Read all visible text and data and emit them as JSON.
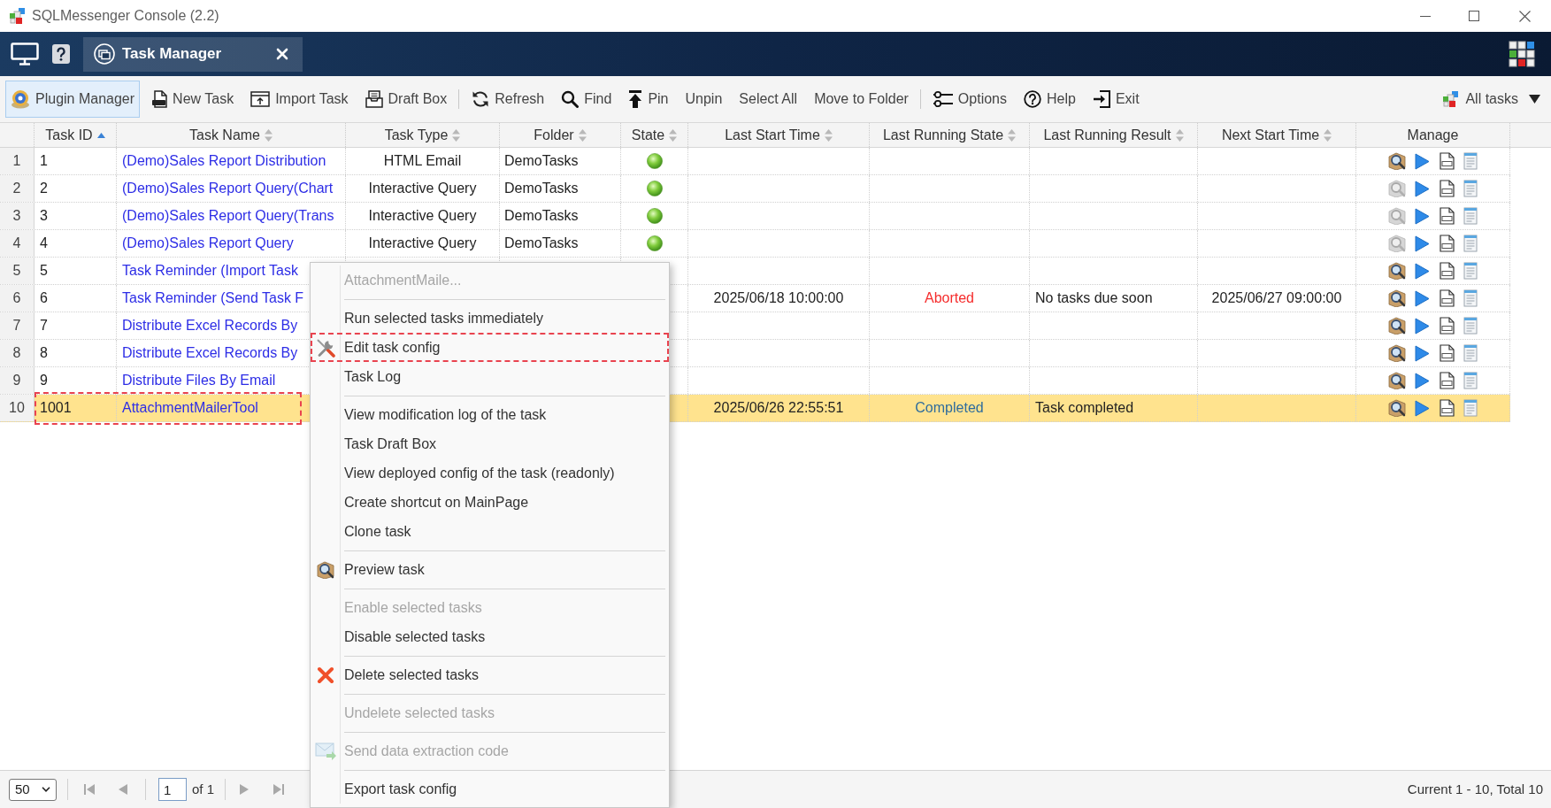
{
  "window": {
    "title": "SQLMessenger Console (2.2)"
  },
  "tabs": [
    {
      "label": "Task Manager",
      "selected": true
    }
  ],
  "toolbar": {
    "groups": [
      {
        "items": [
          {
            "label": "Plugin Manager",
            "highlighted": true
          },
          {
            "label": "New Task",
            "highlighted": false
          },
          {
            "label": "Import Task",
            "highlighted": false
          },
          {
            "label": "Draft Box",
            "highlighted": false
          }
        ]
      },
      {
        "items": [
          {
            "label": "Refresh",
            "highlighted": false
          },
          {
            "label": "Find",
            "highlighted": false
          },
          {
            "label": "Pin",
            "highlighted": false
          },
          {
            "label": "Unpin",
            "highlighted": false
          },
          {
            "label": "Select All",
            "highlighted": false
          },
          {
            "label": "Move to Folder",
            "highlighted": false
          }
        ]
      },
      {
        "items": [
          {
            "label": "Options",
            "highlighted": false
          },
          {
            "label": "Help",
            "highlighted": false
          },
          {
            "label": "Exit",
            "highlighted": false
          }
        ]
      }
    ],
    "filter": {
      "label": "All tasks"
    }
  },
  "table": {
    "columns": [
      {
        "label": "Task ID",
        "sorted": true
      },
      {
        "label": "Task Name",
        "sorted": false
      },
      {
        "label": "Task Type",
        "sorted": false
      },
      {
        "label": "Folder",
        "sorted": false
      },
      {
        "label": "State",
        "sorted": false
      },
      {
        "label": "Last Start Time",
        "sorted": false
      },
      {
        "label": "Last Running State",
        "sorted": false
      },
      {
        "label": "Last Running Result",
        "sorted": false
      },
      {
        "label": "Next Start Time",
        "sorted": false
      },
      {
        "label": "Manage"
      }
    ],
    "rows": [
      {
        "number": "1",
        "task_id": "1",
        "task_name": "(Demo)Sales Report Distribution",
        "task_type": "HTML Email",
        "folder": "DemoTasks",
        "state_on": true,
        "preview_enabled": true,
        "selected": false,
        "outlined": false
      },
      {
        "number": "2",
        "task_id": "2",
        "task_name": "(Demo)Sales Report Query(Chart",
        "task_type": "Interactive Query",
        "folder": "DemoTasks",
        "state_on": true,
        "preview_enabled": false,
        "selected": false,
        "outlined": false
      },
      {
        "number": "3",
        "task_id": "3",
        "task_name": "(Demo)Sales Report Query(Trans",
        "task_type": "Interactive Query",
        "folder": "DemoTasks",
        "state_on": true,
        "preview_enabled": false,
        "selected": false,
        "outlined": false
      },
      {
        "number": "4",
        "task_id": "4",
        "task_name": "(Demo)Sales Report Query",
        "task_type": "Interactive Query",
        "folder": "DemoTasks",
        "state_on": true,
        "preview_enabled": false,
        "selected": false,
        "outlined": false
      },
      {
        "number": "5",
        "task_id": "5",
        "task_name": "Task Reminder (Import Task",
        "preview_enabled": true,
        "selected": false,
        "outlined": false
      },
      {
        "number": "6",
        "task_id": "6",
        "task_name": "Task Reminder (Send Task F",
        "last_start_time": "2025/06/18 10:00:00",
        "last_running_state": {
          "text": "Aborted",
          "color": "#f52c2c"
        },
        "last_running_result": "No tasks due soon",
        "next_start_time": "2025/06/27 09:00:00",
        "preview_enabled": true,
        "selected": false,
        "outlined": false
      },
      {
        "number": "7",
        "task_id": "7",
        "task_name": "Distribute Excel Records By",
        "preview_enabled": true,
        "selected": false,
        "outlined": false
      },
      {
        "number": "8",
        "task_id": "8",
        "task_name": "Distribute Excel Records By",
        "preview_enabled": true,
        "selected": false,
        "outlined": false
      },
      {
        "number": "9",
        "task_id": "9",
        "task_name": "Distribute Files By Email",
        "preview_enabled": true,
        "selected": false,
        "outlined": false
      },
      {
        "number": "10",
        "task_id": "1001",
        "task_name": "AttachmentMailerTool",
        "last_start_time": "2025/06/26 22:55:51",
        "last_running_state": {
          "text": "Completed",
          "color": "#2e6c9c"
        },
        "last_running_result": "Task completed",
        "preview_enabled": true,
        "selected": true,
        "outlined": true
      }
    ]
  },
  "context_menu": {
    "groups": [
      {
        "items": [
          {
            "label": "AttachmentMaile...",
            "disabled": true,
            "outlined": false
          }
        ]
      },
      {
        "items": [
          {
            "label": "Run selected tasks immediately",
            "disabled": false,
            "outlined": false
          },
          {
            "label": "Edit task config",
            "disabled": false,
            "outlined": true
          },
          {
            "label": "Task Log",
            "disabled": false,
            "outlined": false
          }
        ]
      },
      {
        "items": [
          {
            "label": "View modification log of the task",
            "disabled": false,
            "outlined": false
          },
          {
            "label": "Task Draft Box",
            "disabled": false,
            "outlined": false
          },
          {
            "label": "View deployed config of the task (readonly)",
            "disabled": false,
            "outlined": false
          },
          {
            "label": "Create shortcut on MainPage",
            "disabled": false,
            "outlined": false
          },
          {
            "label": "Clone task",
            "disabled": false,
            "outlined": false
          }
        ]
      },
      {
        "items": [
          {
            "label": "Preview task",
            "disabled": false,
            "outlined": false
          }
        ]
      },
      {
        "items": [
          {
            "label": "Enable selected tasks",
            "disabled": true,
            "outlined": false
          },
          {
            "label": "Disable selected tasks",
            "disabled": false,
            "outlined": false
          }
        ]
      },
      {
        "items": [
          {
            "label": "Delete selected tasks",
            "disabled": false,
            "outlined": false
          }
        ]
      },
      {
        "items": [
          {
            "label": "Undelete selected tasks",
            "disabled": true,
            "outlined": false
          }
        ]
      },
      {
        "items": [
          {
            "label": "Send data extraction code",
            "disabled": true,
            "outlined": false
          }
        ]
      },
      {
        "items": [
          {
            "label": "Export task config",
            "disabled": false,
            "outlined": false
          }
        ]
      }
    ]
  },
  "pagination": {
    "page_size": "50",
    "page": "1",
    "page_count": "of 1",
    "summary": "Current 1 - 10, Total 10"
  }
}
